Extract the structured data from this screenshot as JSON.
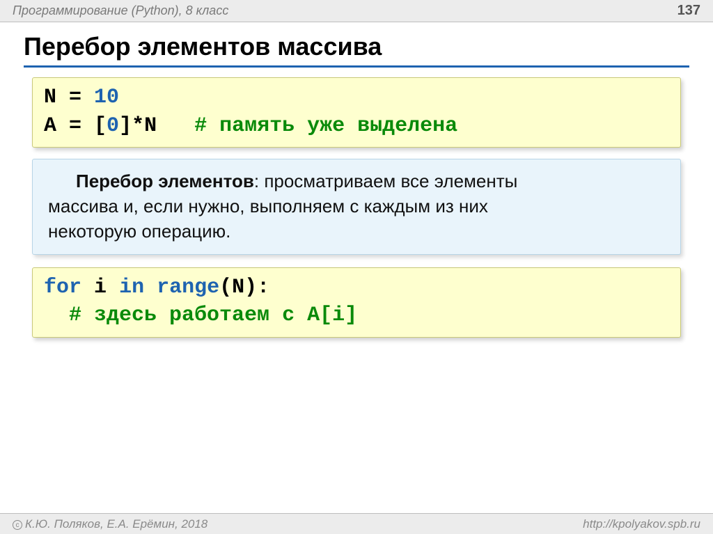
{
  "header": {
    "course": "Программирование (Python), 8 класс",
    "page": "137"
  },
  "title": "Перебор элементов массива",
  "code1": {
    "l1": {
      "a": "N",
      "eq": " = ",
      "n": "10"
    },
    "l2": {
      "a": "A",
      "eq": " = ",
      "br1": "[",
      "z": "0",
      "br2": "]*N",
      "sp": "   ",
      "c": "# память уже выделена"
    }
  },
  "definition": {
    "term": "Перебор элементов",
    "colon": ": ",
    "tail1": "просматриваем все элементы",
    "line2": "массива и, если нужно, выполняем с каждым из них",
    "line3": "некоторую операцию."
  },
  "code2": {
    "l1": {
      "for": "for",
      "sp1": " ",
      "i": "i",
      "sp2": " ",
      "in": "in",
      "sp3": " ",
      "range": "range",
      "p1": "(",
      "n": "N",
      "p2": "):"
    },
    "l2": {
      "indent": "  ",
      "c": "# здесь работаем с A[i]"
    }
  },
  "footer": {
    "authors": "К.Ю. Поляков, Е.А. Ерёмин, 2018",
    "url": "http://kpolyakov.spb.ru"
  }
}
